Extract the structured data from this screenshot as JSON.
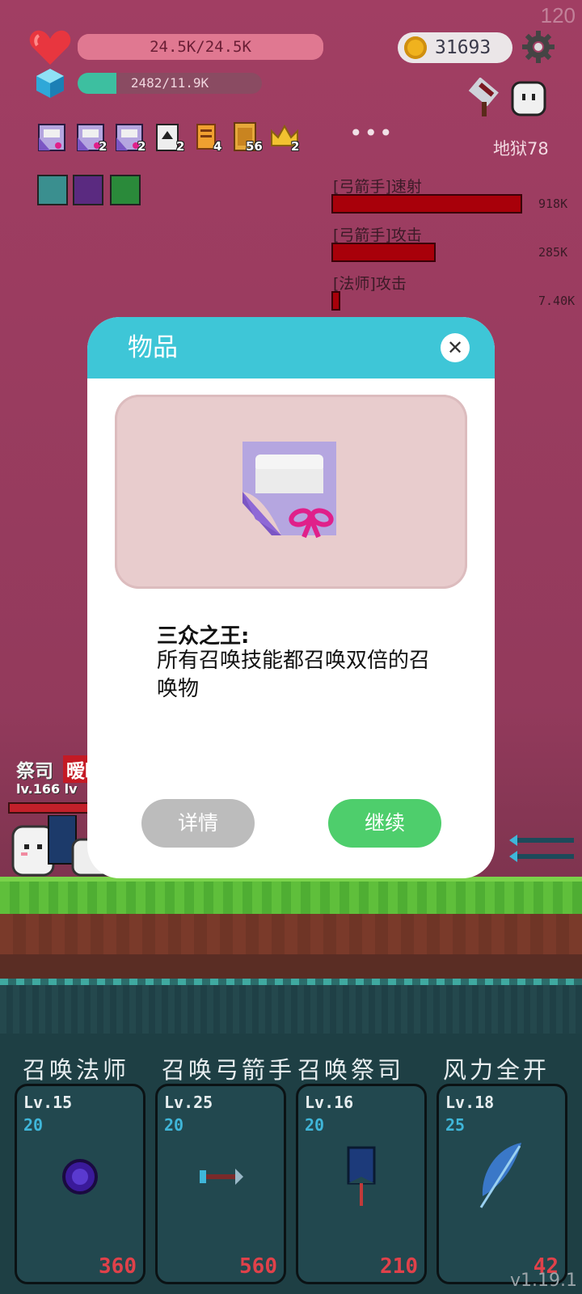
{
  "fps": "120",
  "hud": {
    "hp_text": "24.5K/24.5K",
    "hp_fraction": 1.0,
    "xp_text": "2482/11.9K",
    "xp_fraction": 0.21,
    "coins": "31693",
    "hell_level": "地狱78",
    "more": "•••"
  },
  "inventory": [
    {
      "icon": "summon-scroll-icon",
      "count": ""
    },
    {
      "icon": "summon-scroll-icon",
      "count": "2"
    },
    {
      "icon": "summon-scroll-icon",
      "count": "2"
    },
    {
      "icon": "playing-card-icon",
      "count": "2"
    },
    {
      "icon": "scroll-icon",
      "count": "4"
    },
    {
      "icon": "book-icon",
      "count": "56"
    },
    {
      "icon": "crown-icon",
      "count": "2"
    }
  ],
  "damage_stats": [
    {
      "label": "[弓箭手]速射",
      "value": "918K",
      "fraction": 1.0
    },
    {
      "label": "[弓箭手]攻击",
      "value": "285K",
      "fraction": 0.54
    },
    {
      "label": "[法师]攻击",
      "value": "7.40K",
      "fraction": 0.03
    }
  ],
  "character": {
    "name_part1": "祭司",
    "name_part2": "暧昧",
    "level": "lv.166  lv"
  },
  "dialog": {
    "title": "物品",
    "close": "✕",
    "item_name": "三众之王:",
    "item_desc": "所有召唤技能都召唤双倍的召唤物",
    "details_label": "详情",
    "continue_label": "继续"
  },
  "skills": [
    {
      "title": "召唤法师",
      "level": "Lv.15",
      "cost": "20",
      "cooldown": "360",
      "icon": "dark-orb-icon"
    },
    {
      "title": "召唤弓箭手",
      "level": "Lv.25",
      "cost": "20",
      "cooldown": "560",
      "icon": "arrow-icon"
    },
    {
      "title": "召唤祭司",
      "level": "Lv.16",
      "cost": "20",
      "cooldown": "210",
      "icon": "banner-icon"
    },
    {
      "title": "风力全开",
      "level": "Lv.18",
      "cost": "25",
      "cooldown": "42",
      "icon": "feather-icon"
    }
  ],
  "version": "v1.19.1",
  "colors": {
    "header": "#3ec6d7",
    "continue": "#4ece6c",
    "details": "#bcbcbc",
    "damage_bar": "#a8000a"
  }
}
